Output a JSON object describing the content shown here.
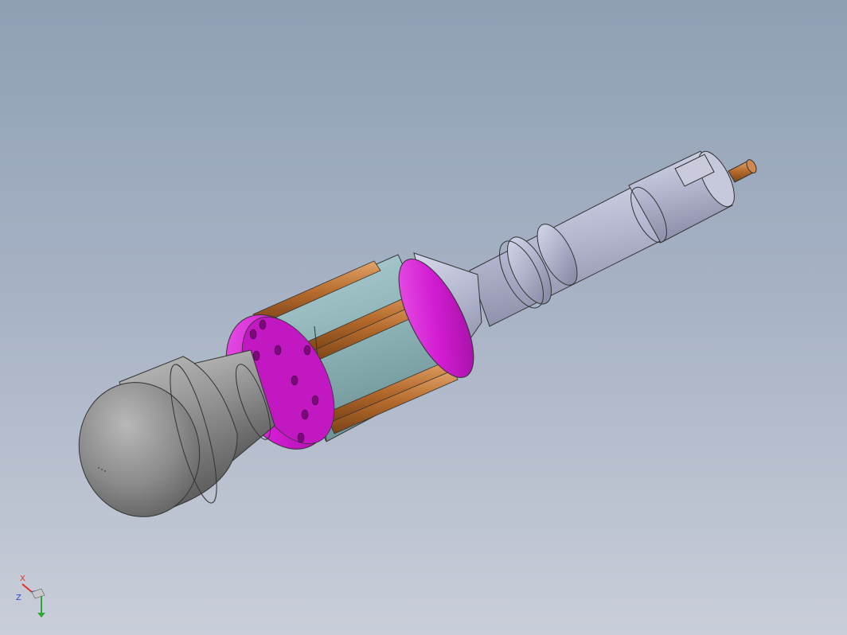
{
  "colors": {
    "viewport_top": "#8f9fb4",
    "viewport_bottom": "#c9ced9",
    "head_gray": "#8e8e8e",
    "shaft_lavender": "#b9bbd4",
    "flange_magenta": "#d21cd2",
    "core_teal": "#8fb4b8",
    "copper_bar": "#b56a2c",
    "axis_x": "#e0302a",
    "axis_y": "#2aa830",
    "axis_z": "#2a46d0"
  },
  "triad": {
    "x_label": "X",
    "z_label": "Z"
  }
}
